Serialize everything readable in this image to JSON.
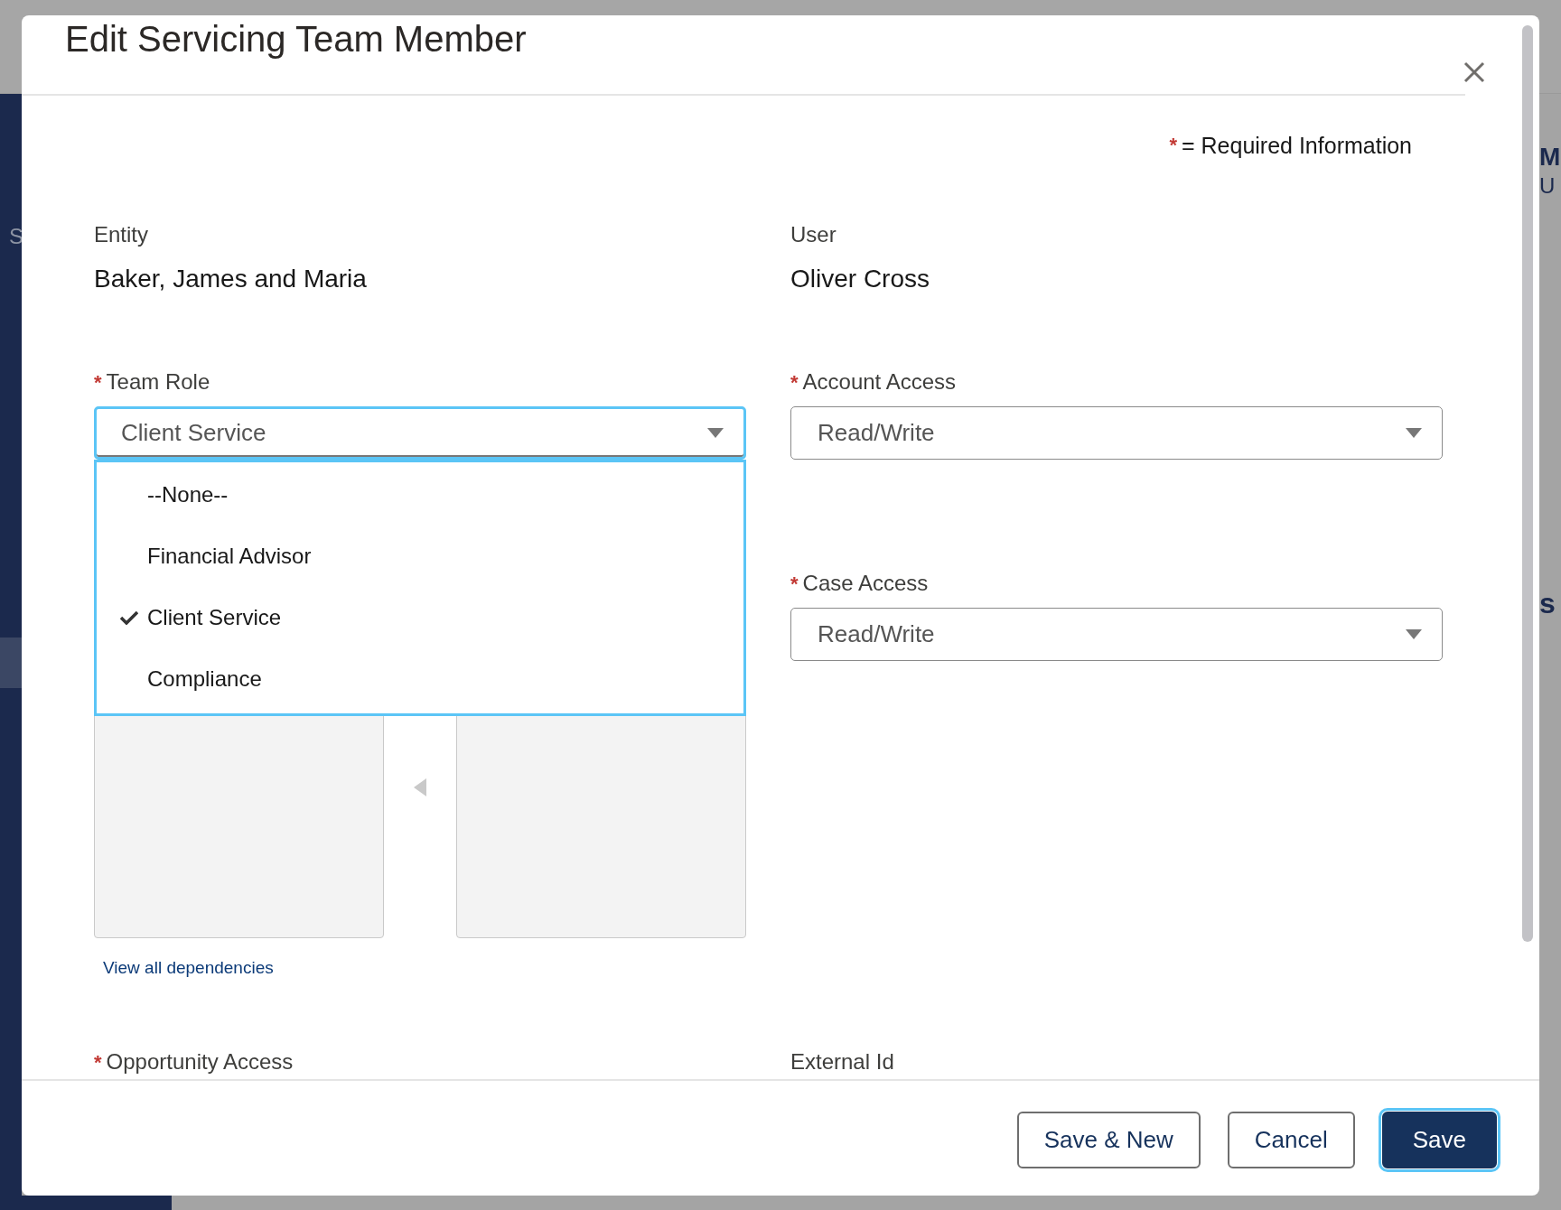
{
  "background": {
    "left_fragments": [
      "S"
    ],
    "right_fragments": [
      "M",
      "U",
      "s"
    ]
  },
  "modal": {
    "title": "Edit Servicing Team Member",
    "required_note": {
      "mark": "*",
      "text": "= Required Information"
    },
    "rows": [
      {
        "columns": [
          [
            {
              "kind": "readonly",
              "label": "Entity",
              "value": "Baker, James and Maria"
            }
          ],
          [
            {
              "kind": "readonly",
              "label": "User",
              "value": "Oliver Cross"
            }
          ]
        ]
      },
      {
        "columns": [
          [
            {
              "kind": "picklist",
              "label": "Team Role",
              "required": true,
              "value": "Client Service",
              "focused": true,
              "expanded": true,
              "options": [
                {
                  "label": "--None--",
                  "selected": false
                },
                {
                  "label": "Financial Advisor",
                  "selected": false
                },
                {
                  "label": "Client Service",
                  "selected": true
                },
                {
                  "label": "Compliance",
                  "selected": false
                }
              ]
            },
            {
              "kind": "dual_listbox",
              "link": "View all dependencies"
            }
          ],
          [
            {
              "kind": "picklist",
              "label": "Account Access",
              "required": true,
              "value": "Read/Write",
              "focused": false
            },
            {
              "kind": "picklist",
              "label": "Case Access",
              "required": true,
              "value": "Read/Write",
              "focused": false
            }
          ]
        ]
      },
      {
        "columns": [
          [
            {
              "kind": "label_only",
              "label": "Opportunity Access",
              "required": true
            }
          ],
          [
            {
              "kind": "label_only",
              "label": "External Id",
              "required": false
            }
          ]
        ]
      }
    ],
    "buttons": [
      {
        "label": "Save & New",
        "kind": "neutral",
        "focused": false
      },
      {
        "label": "Cancel",
        "kind": "neutral",
        "focused": false
      },
      {
        "label": "Save",
        "kind": "brand",
        "focused": true
      }
    ]
  }
}
